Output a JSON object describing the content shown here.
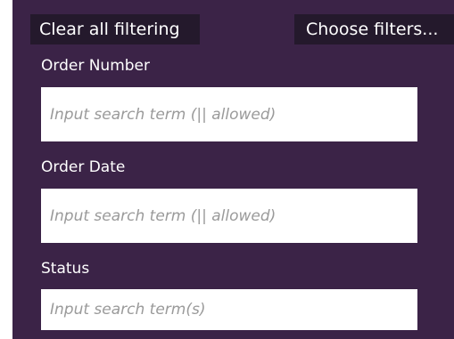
{
  "toolbar": {
    "clear_label": "Clear all filtering",
    "choose_label": "Choose filters..."
  },
  "filters": [
    {
      "label": "Order Number",
      "value": "",
      "placeholder": "Input search term (|| allowed)"
    },
    {
      "label": "Order Date",
      "value": "",
      "placeholder": "Input search term (|| allowed)"
    },
    {
      "label": "Status",
      "value": "",
      "placeholder": "Input search term(s)"
    }
  ],
  "colors": {
    "panel_background": "#3b2347",
    "button_background": "#24192c",
    "text": "#ffffff",
    "placeholder": "#9a9a9a"
  }
}
